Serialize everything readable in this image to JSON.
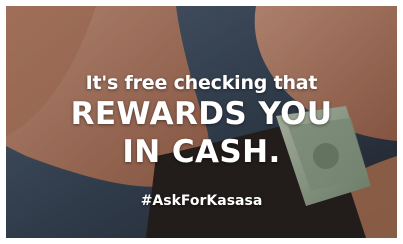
{
  "ad": {
    "intro": "It's free checking that",
    "headline_line1": "REWARDS YOU",
    "headline_line2": "IN CASH.",
    "hashtag": "#AskForKasasa"
  },
  "colors": {
    "text": "#ffffff",
    "background": "#3d4a5a",
    "skin": "#c98a6c",
    "wallet": "#2a2320",
    "bill": "#9fb39a"
  }
}
